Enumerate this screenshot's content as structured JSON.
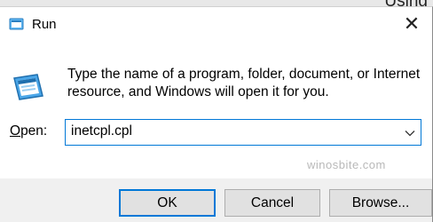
{
  "background_window": {
    "text": "Using"
  },
  "titlebar": {
    "title": "Run",
    "close_glyph": "✕",
    "icon": "run-app-icon"
  },
  "body": {
    "icon": "run-app-icon",
    "message": "Type the name of a program, folder, document, or Internet resource, and Windows will open it for you."
  },
  "open": {
    "label_accel": "O",
    "label_rest": "pen:",
    "value": "inetcpl.cpl"
  },
  "watermark": "winosbite.com",
  "buttons": {
    "ok": "OK",
    "cancel": "Cancel",
    "browse": "Browse..."
  },
  "colors": {
    "accent": "#0078d7",
    "footer_bg": "#f0f0f0",
    "button_bg": "#e1e1e1"
  }
}
